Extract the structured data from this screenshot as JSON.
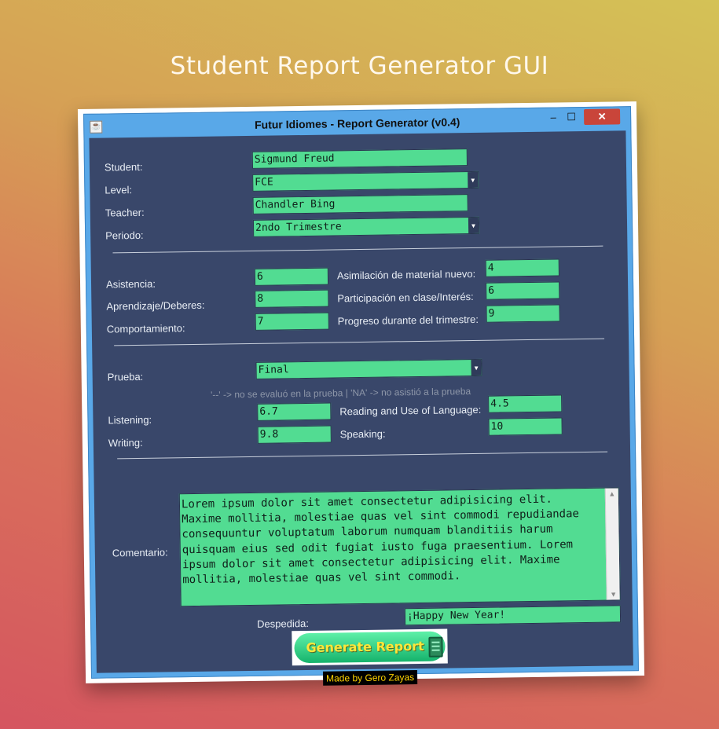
{
  "page": {
    "title": "Student Report Generator GUI"
  },
  "window": {
    "title": "Futur Idiomes - Report Generator (v0.4)",
    "minimize": "–",
    "maximize": "☐",
    "close": "✕"
  },
  "student_info": {
    "student_label": "Student:",
    "student_value": "Sigmund Freud",
    "level_label": "Level:",
    "level_value": "FCE",
    "teacher_label": "Teacher:",
    "teacher_value": "Chandler Bing",
    "periodo_label": "Periodo:",
    "periodo_value": "2ndo Trimestre"
  },
  "scores": {
    "asistencia_label": "Asistencia:",
    "asistencia_value": "6",
    "aprendizaje_label": "Aprendizaje/Deberes:",
    "aprendizaje_value": "8",
    "comportamiento_label": "Comportamiento:",
    "comportamiento_value": "7",
    "asimilacion_label": "Asimilación de material nuevo:",
    "asimilacion_value": "4",
    "participacion_label": "Participación en clase/Interés:",
    "participacion_value": "6",
    "progreso_label": "Progreso durante del trimestre:",
    "progreso_value": "9"
  },
  "exam": {
    "prueba_label": "Prueba:",
    "prueba_value": "Final",
    "hint": "'--' -> no se evaluó en la prueba    |    'NA' -> no asistió a la prueba",
    "listening_label": "Listening:",
    "listening_value": "6.7",
    "writing_label": "Writing:",
    "writing_value": "9.8",
    "reading_label": "Reading and Use of Language:",
    "reading_value": "4.5",
    "speaking_label": "Speaking:",
    "speaking_value": "10"
  },
  "comment": {
    "label": "Comentario:",
    "text": "Lorem ipsum dolor sit amet consectetur adipisicing elit.\nMaxime mollitia, molestiae quas vel sint commodi repudiandae\nconsequuntur voluptatum laborum numquam blanditiis harum\nquisquam eius sed odit fugiat iusto fuga praesentium. Lorem\nipsum dolor sit amet consectetur adipisicing elit. Maxime\nmollitia, molestiae quas vel sint commodi."
  },
  "despedida": {
    "label": "Despedida:",
    "value": "¡Happy New Year!"
  },
  "generate_button": {
    "label": "Generate Report",
    "icon": "document-icon"
  },
  "credit": "Made by Gero Zayas",
  "colors": {
    "field": "#52dc92",
    "panel": "#39476a",
    "titlebar": "#59a8e8",
    "button_text": "#ffe63a"
  }
}
